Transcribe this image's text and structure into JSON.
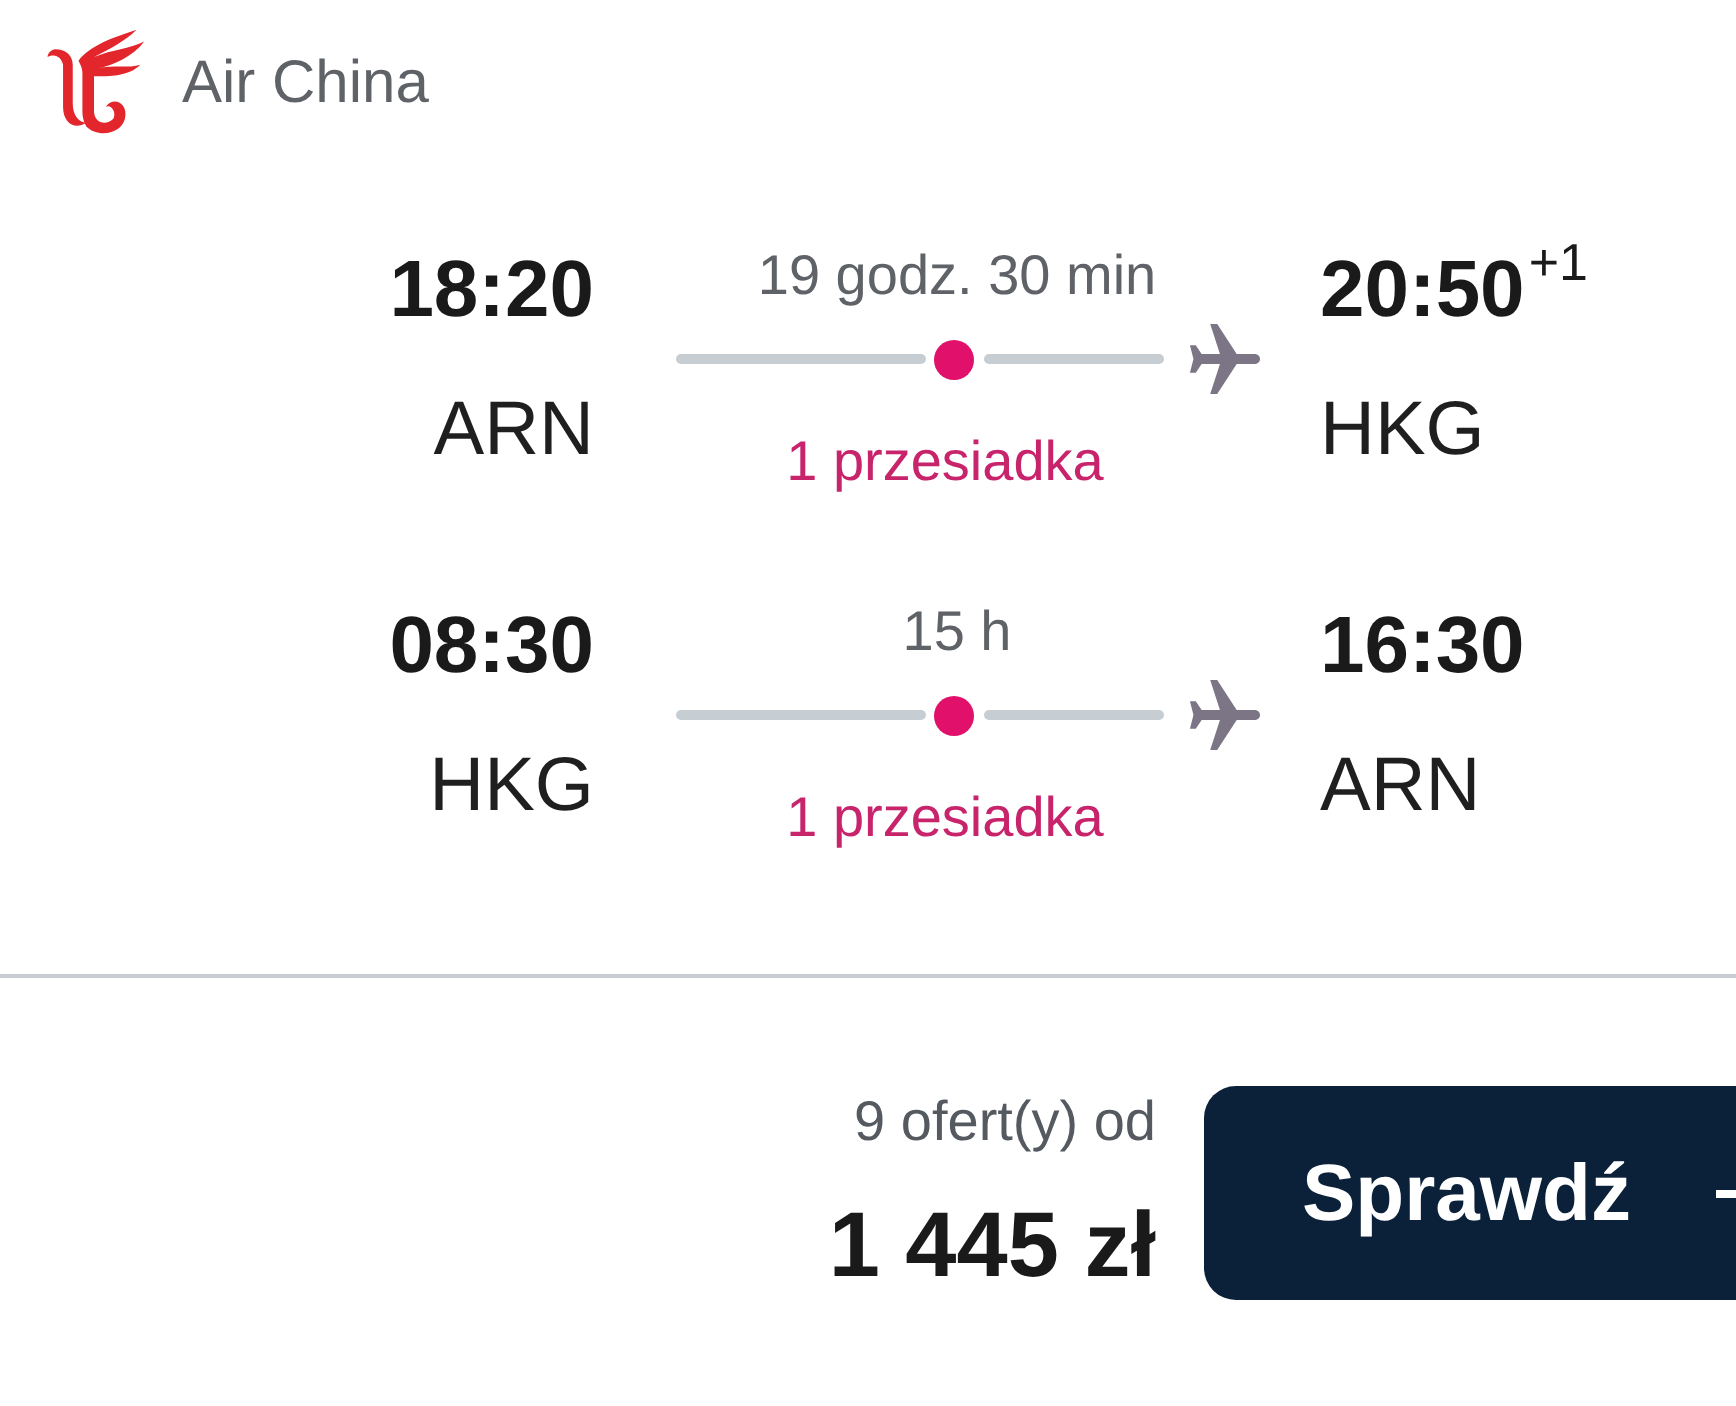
{
  "airline": {
    "name": "Air China"
  },
  "legs": [
    {
      "departure": {
        "time": "18:20",
        "airport": "ARN"
      },
      "duration": "19 godz. 30 min",
      "stops": "1 przesiadka",
      "arrival": {
        "time": "20:50",
        "day_offset": "+1",
        "airport": "HKG"
      }
    },
    {
      "departure": {
        "time": "08:30",
        "airport": "HKG"
      },
      "duration": "15 h",
      "stops": "1 przesiadka",
      "arrival": {
        "time": "16:30",
        "airport": "ARN"
      }
    }
  ],
  "price": {
    "offers": "9 ofert(y) od",
    "amount": "1 445 zł"
  },
  "button": {
    "label": "Sprawdź"
  }
}
